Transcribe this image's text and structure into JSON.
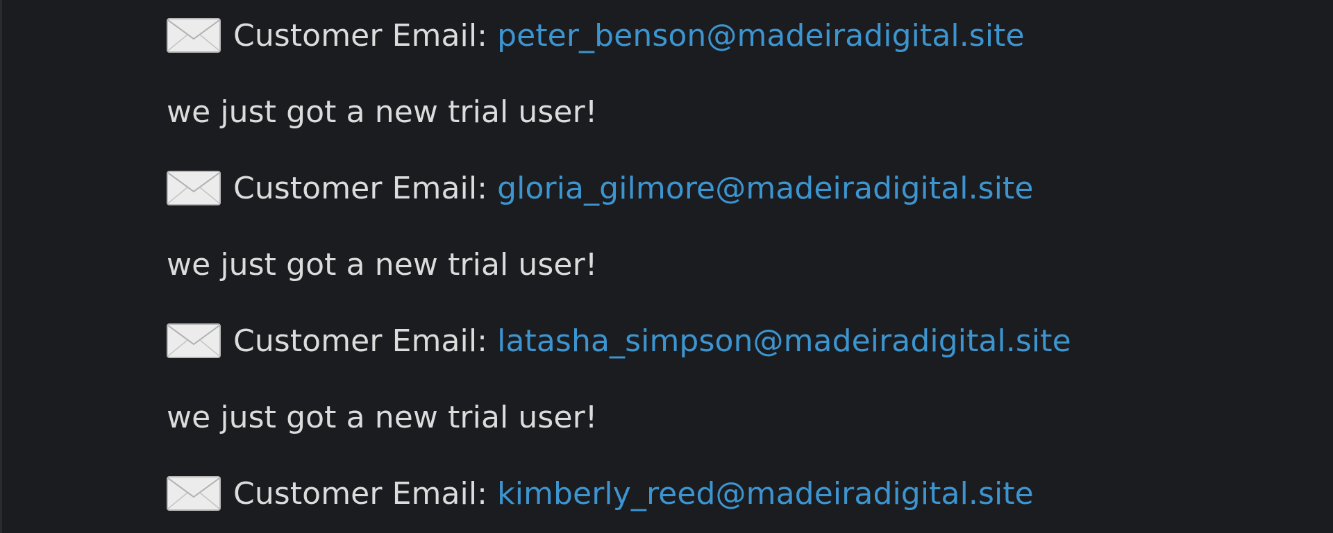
{
  "colors": {
    "background": "#1b1c20",
    "text": "#dcdcdc",
    "link": "#3d95d0"
  },
  "feed": [
    {
      "type": "email",
      "icon": "envelope-icon",
      "label": "Customer Email:",
      "email": "peter_benson@madeiradigital.site"
    },
    {
      "type": "message",
      "text": "we just got a new trial user!"
    },
    {
      "type": "email",
      "icon": "envelope-icon",
      "label": "Customer Email:",
      "email": "gloria_gilmore@madeiradigital.site"
    },
    {
      "type": "message",
      "text": "we just got a new trial user!"
    },
    {
      "type": "email",
      "icon": "envelope-icon",
      "label": "Customer Email:",
      "email": "latasha_simpson@madeiradigital.site"
    },
    {
      "type": "message",
      "text": "we just got a new trial user!"
    },
    {
      "type": "email",
      "icon": "envelope-icon",
      "label": "Customer Email:",
      "email": "kimberly_reed@madeiradigital.site"
    }
  ]
}
